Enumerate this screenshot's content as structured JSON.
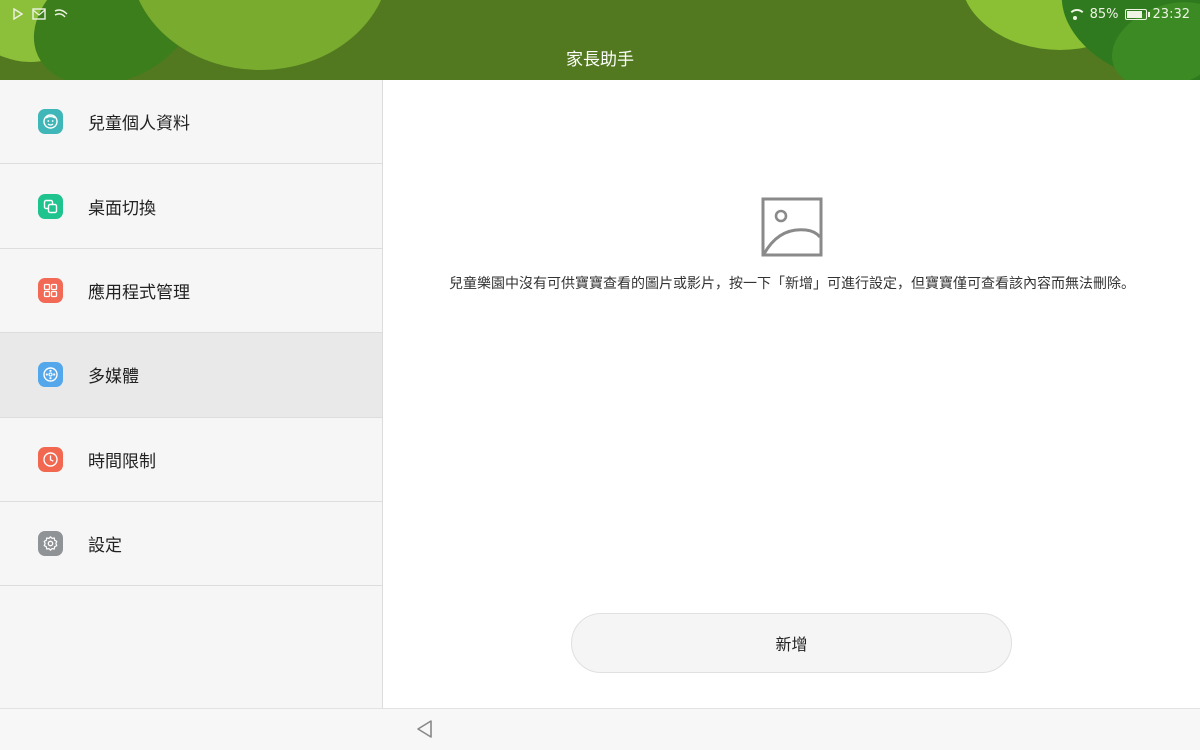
{
  "status_bar": {
    "left_icons": [
      "play-store-icon",
      "mail-icon",
      "swipe-icon"
    ],
    "battery_percent": "85%",
    "battery_level": 0.85,
    "time": "23:32"
  },
  "header": {
    "title": "家長助手"
  },
  "sidebar": {
    "items": [
      {
        "label": "兒童個人資料",
        "icon": "child-profile-icon",
        "color": "#3fb6b8",
        "active": false
      },
      {
        "label": "桌面切換",
        "icon": "desktop-switch-icon",
        "color": "#1ec38e",
        "active": false
      },
      {
        "label": "應用程式管理",
        "icon": "app-management-icon",
        "color": "#f26a55",
        "active": false
      },
      {
        "label": "多媒體",
        "icon": "multimedia-icon",
        "color": "#53a7ea",
        "active": true
      },
      {
        "label": "時間限制",
        "icon": "clock-icon",
        "color": "#f2674f",
        "active": false
      },
      {
        "label": "設定",
        "icon": "settings-gear-icon",
        "color": "#8f9396",
        "active": false
      }
    ]
  },
  "main": {
    "placeholder_icon": "image-placeholder-icon",
    "message": "兒童樂園中沒有可供寶寶查看的圖片或影片，按一下「新增」可進行設定，但寶寶僅可查看該內容而無法刪除。",
    "add_button_label": "新增"
  },
  "navbar": {
    "back_icon": "back-triangle-icon"
  }
}
